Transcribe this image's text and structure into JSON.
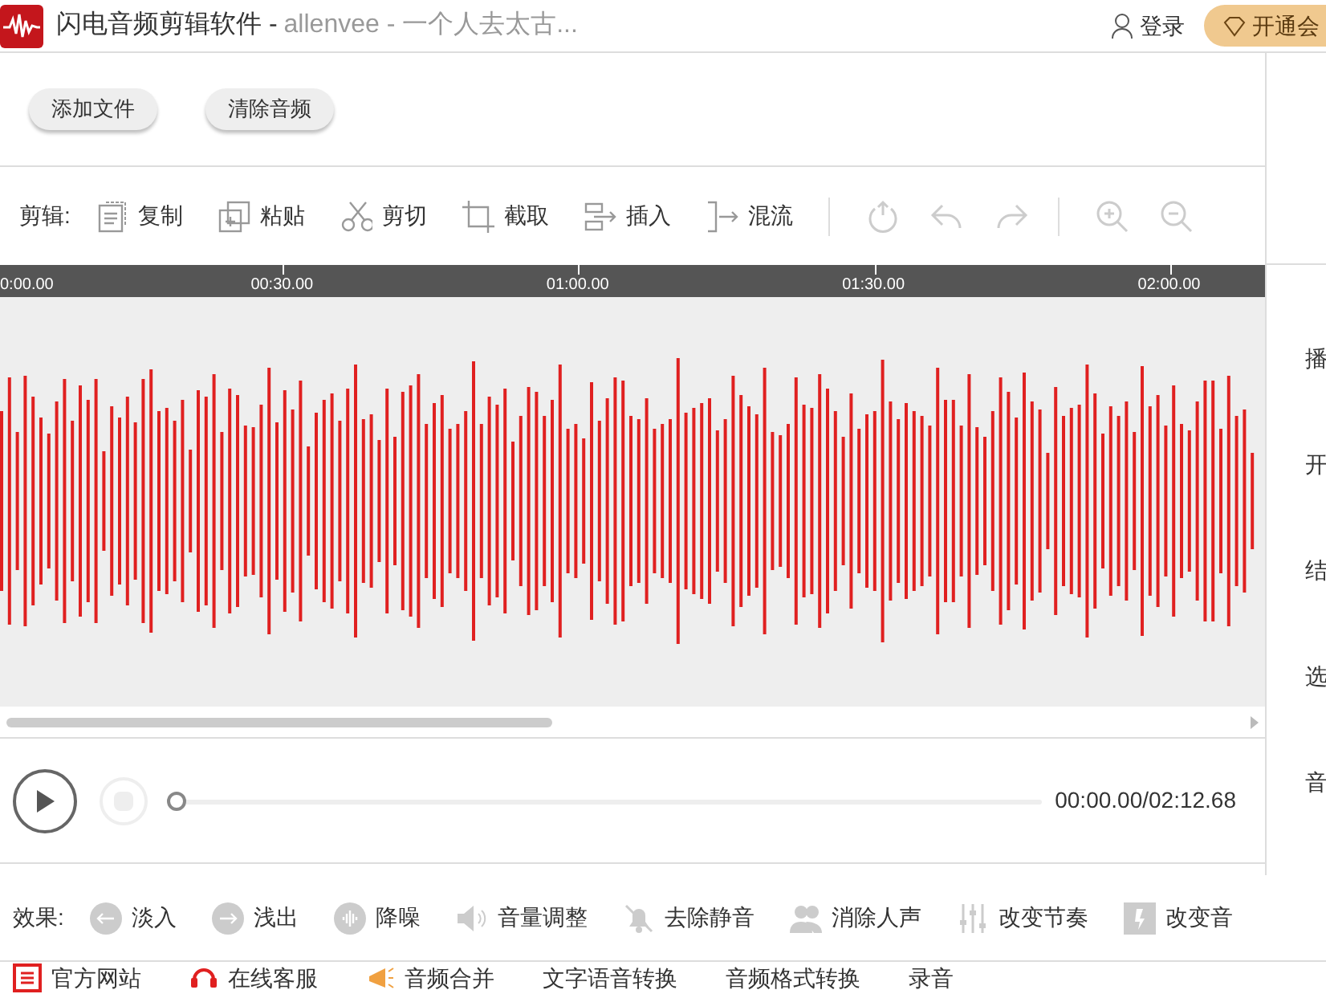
{
  "window": {
    "title": "闪电音频剪辑软件 - ",
    "subtitle": "allenvee - 一个人去太古...",
    "login": "登录",
    "vip": "开通会"
  },
  "file_buttons": [
    "添加文件",
    "清除音频"
  ],
  "edit_toolbar": {
    "label": "剪辑:",
    "items": [
      {
        "kind": "copy",
        "label": "复制",
        "disabled": false
      },
      {
        "kind": "paste",
        "label": "粘贴",
        "disabled": false
      },
      {
        "kind": "cut",
        "label": "剪切",
        "disabled": false
      },
      {
        "kind": "crop",
        "label": "截取",
        "disabled": false
      },
      {
        "kind": "insert",
        "label": "插入",
        "disabled": false
      },
      {
        "kind": "mix",
        "label": "混流",
        "disabled": false
      }
    ]
  },
  "timeline": {
    "ticks": [
      "0:00.00",
      "00:30.00",
      "01:00.00",
      "01:30.00",
      "02:00.00"
    ]
  },
  "player": {
    "time": "00:00.00/02:12.68",
    "level": 0
  },
  "right_panel": [
    "播",
    "开",
    "结",
    "选",
    "音"
  ],
  "effects": {
    "label": "效果:",
    "items": [
      {
        "kind": "fade-in",
        "label": "淡入"
      },
      {
        "kind": "fade-out",
        "label": "浅出"
      },
      {
        "kind": "denoise",
        "label": "降噪"
      },
      {
        "kind": "volume",
        "label": "音量调整"
      },
      {
        "kind": "mute",
        "label": "去除静音"
      },
      {
        "kind": "vocal",
        "label": "消除人声"
      },
      {
        "kind": "tempo",
        "label": "改变节奏"
      },
      {
        "kind": "pitch",
        "label": "改变音"
      }
    ]
  },
  "footer_links": [
    {
      "kind": "site",
      "label": "官方网站"
    },
    {
      "kind": "service",
      "label": "在线客服"
    },
    {
      "kind": "merge",
      "label": "音频合并"
    },
    {
      "kind": "plain",
      "label": "文字语音转换"
    },
    {
      "kind": "plain",
      "label": "音频格式转换"
    },
    {
      "kind": "plain",
      "label": "录音"
    }
  ]
}
